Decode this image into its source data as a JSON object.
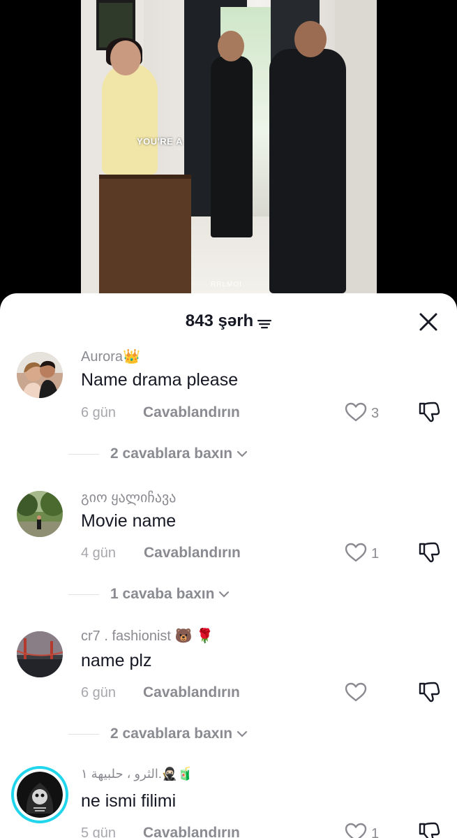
{
  "video": {
    "caption": "YOU'RE A",
    "watermark": "RRLMOI"
  },
  "sheet": {
    "count_label": "843 şərh",
    "filter_icon": "filter-icon",
    "close_icon": "close-icon"
  },
  "comments": [
    {
      "username": "Aurora👑",
      "text": "Name drama please",
      "time": "6 gün",
      "reply_label": "Cavablandırın",
      "likes": "3",
      "view_replies": "2 cavablara baxın"
    },
    {
      "username": "გიო ყალიჩავა",
      "text": "Movie name",
      "time": "4 gün",
      "reply_label": "Cavablandırın",
      "likes": "1",
      "view_replies": "1 cavaba baxın"
    },
    {
      "username": "cr7 . fashionist 🐻 🌹",
      "text": "name plz",
      "time": "6 gün",
      "reply_label": "Cavablandırın",
      "likes": "",
      "view_replies": "2 cavablara baxın"
    },
    {
      "username": "الثرو ، حلبيهة ١.🥷🏻🧃",
      "text": "ne ismi filimi",
      "time": "5 gün",
      "reply_label": "Cavablandırın",
      "likes": "1"
    }
  ],
  "colors": {
    "text_primary": "#161823",
    "text_secondary": "#8a8b91",
    "story_ring": "#20d5ec"
  }
}
